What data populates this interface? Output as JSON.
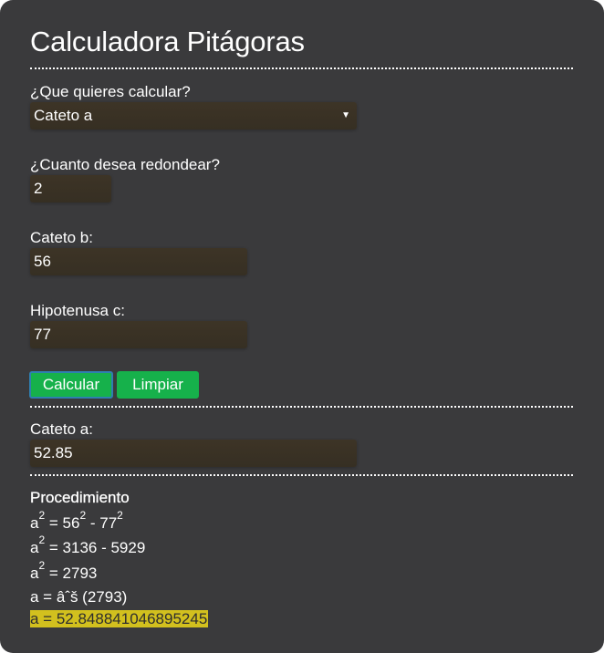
{
  "header": {
    "title": "Calculadora Pitágoras"
  },
  "form": {
    "calc_question": "¿Que quieres calcular?",
    "calc_select_value": "Cateto a",
    "round_question": "¿Cuanto desea redondear?",
    "round_value": "2",
    "cateto_b_label": "Cateto b:",
    "cateto_b_value": "56",
    "hipotenusa_label": "Hipotenusa c:",
    "hipotenusa_value": "77"
  },
  "buttons": {
    "calculate_label": "Calcular",
    "clear_label": "Limpiar",
    "accent_color": "#16b14b"
  },
  "result": {
    "label": "Cateto a:",
    "value": "52.85"
  },
  "procedure": {
    "title": "Procedimiento",
    "step1": {
      "lhs": "a",
      "lhs_exp": "2",
      "op": " = ",
      "b": "56",
      "b_exp": "2",
      "minus": " - ",
      "c": "77",
      "c_exp": "2"
    },
    "step2": {
      "lhs": "a",
      "lhs_exp": "2",
      "rest": " = 3136 - 5929"
    },
    "step3": {
      "lhs": "a",
      "lhs_exp": "2",
      "rest": " = 2793"
    },
    "step4": "a = âˆš (2793)",
    "step5": "a = 52.848841046895245",
    "highlight_color": "#d2c01e"
  }
}
